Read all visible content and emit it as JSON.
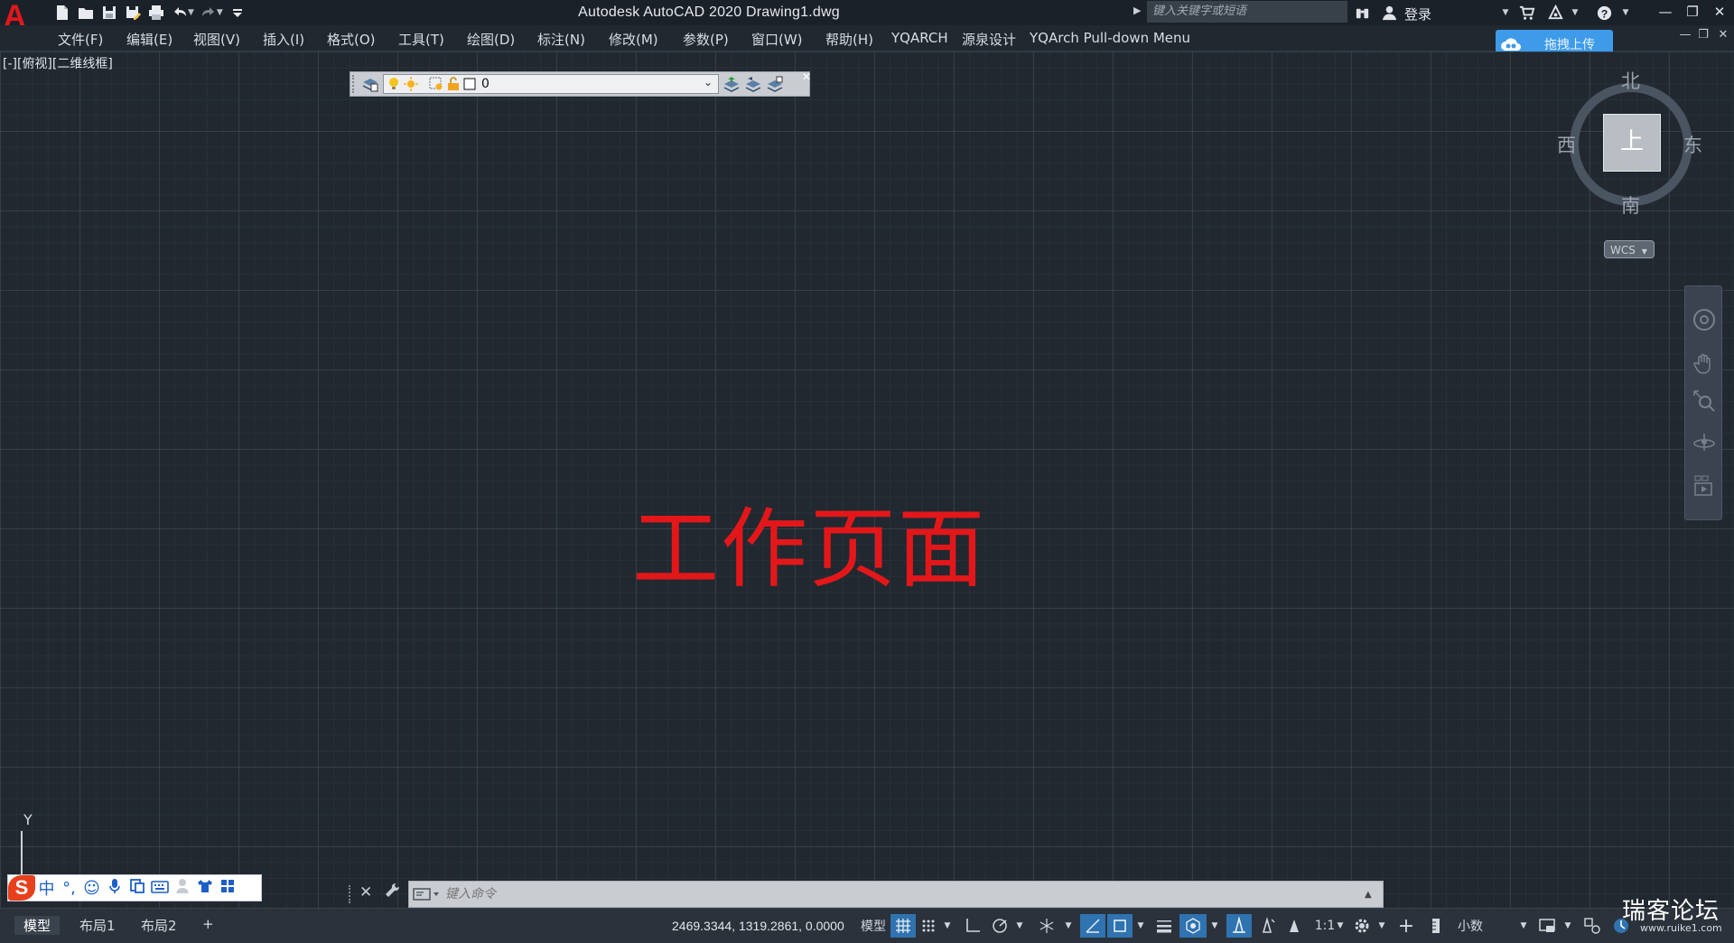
{
  "app": {
    "title": "Autodesk AutoCAD 2020    Drawing1.dwg",
    "logo_letter": "A"
  },
  "titlebar": {
    "search_placeholder": "键入关键字或短语",
    "login_label": "登录"
  },
  "menu": {
    "items": [
      "文件(F)",
      "编辑(E)",
      "视图(V)",
      "插入(I)",
      "格式(O)",
      "工具(T)",
      "绘图(D)",
      "标注(N)",
      "修改(M)",
      "参数(P)",
      "窗口(W)",
      "帮助(H)",
      "YQARCH",
      "源泉设计",
      "YQArch Pull-down Menu"
    ]
  },
  "upload_button": {
    "label": "拖拽上传"
  },
  "viewport": {
    "label": "[-][俯视][二维线框]"
  },
  "layer_toolbar": {
    "current_layer": "0"
  },
  "canvas": {
    "center_text": "工作页面"
  },
  "viewcube": {
    "face": "上",
    "north": "北",
    "south": "南",
    "east": "东",
    "west": "西",
    "wcs_label": "WCS"
  },
  "ucs": {
    "y_label": "Y"
  },
  "ime": {
    "logo": "S",
    "mode": "中",
    "punct": "°,"
  },
  "command_line": {
    "placeholder": "键入命令"
  },
  "statusbar": {
    "tabs": [
      "模型",
      "布局1",
      "布局2"
    ],
    "add_tab": "+",
    "coordinates": "2469.3344, 1319.2861, 0.0000",
    "model_label": "模型",
    "scale": "1:1",
    "units": "小数"
  },
  "watermark": {
    "text": "瑞客论坛",
    "url": "www.ruike1.com"
  },
  "colors": {
    "canvas_bg": "#212830",
    "accent_red": "#e3171a",
    "upload_blue": "#3d9be9",
    "status_active": "#2f73b0"
  }
}
